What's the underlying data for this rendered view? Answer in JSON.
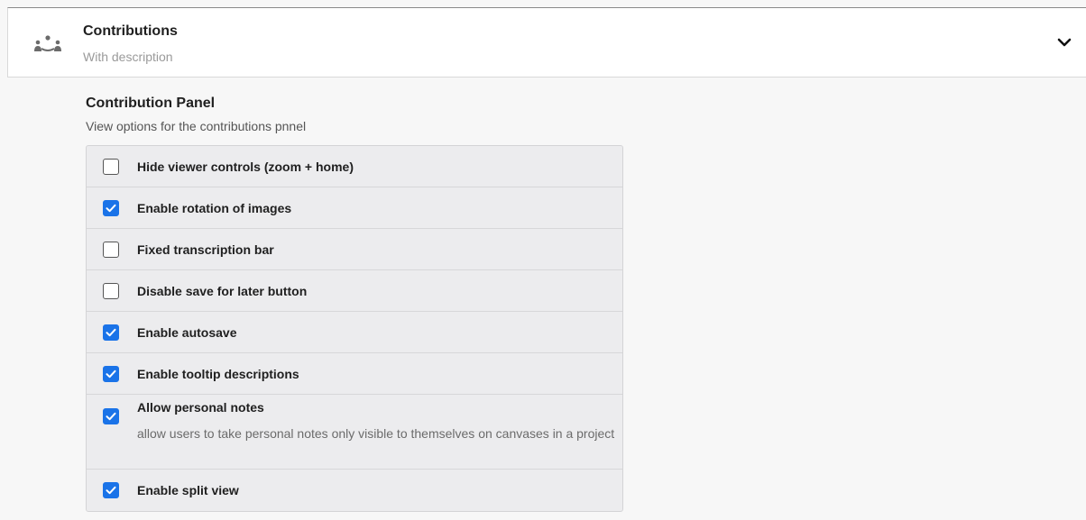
{
  "header": {
    "icon": "contributors-icon",
    "title": "Contributions",
    "subtitle": "With description",
    "expand_icon": "chevron-down-icon"
  },
  "section": {
    "title": "Contribution Panel",
    "description": "View options for the contributions pnnel"
  },
  "options": [
    {
      "label": "Hide viewer controls (zoom + home)",
      "checked": false,
      "description": ""
    },
    {
      "label": "Enable rotation of images",
      "checked": true,
      "description": ""
    },
    {
      "label": "Fixed transcription bar",
      "checked": false,
      "description": ""
    },
    {
      "label": "Disable save for later button",
      "checked": false,
      "description": ""
    },
    {
      "label": "Enable autosave",
      "checked": true,
      "description": ""
    },
    {
      "label": "Enable tooltip descriptions",
      "checked": true,
      "description": ""
    },
    {
      "label": "Allow personal notes",
      "checked": true,
      "description": "allow users to take personal notes only visible to themselves on canvases in a project"
    },
    {
      "label": "Enable split view",
      "checked": true,
      "description": ""
    }
  ],
  "colors": {
    "accent": "#1a73e8",
    "panel_bg": "#ececee",
    "page_bg": "#f7f7f7"
  }
}
